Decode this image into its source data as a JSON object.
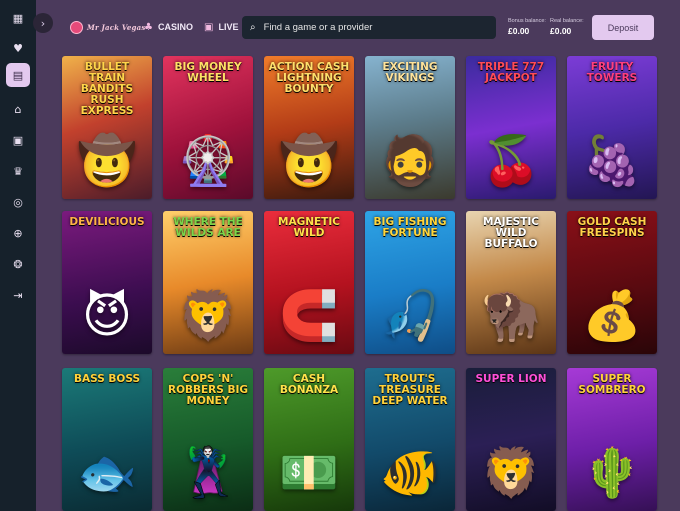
{
  "sidebar": {
    "icons": [
      "grid-icon",
      "heart-icon",
      "casino-chip-icon",
      "bank-icon",
      "gift-icon",
      "trophy-icon",
      "target-icon",
      "plus-circle-icon",
      "coins-icon",
      "logout-icon"
    ],
    "glyphs": [
      "▦",
      "♥",
      "▤",
      "⌂",
      "▣",
      "♛",
      "◎",
      "⊕",
      "❂",
      "⇥"
    ]
  },
  "header": {
    "logo_text": "Mr Jack Vegas",
    "nav": [
      {
        "label": "CASINO",
        "glyph": "♣"
      },
      {
        "label": "LIVE",
        "glyph": "▣"
      }
    ],
    "search": {
      "placeholder": "Find a game or a provider",
      "glyph": "⌕"
    },
    "bonus_balance": {
      "label": "Bonus balance:",
      "value": "£0.00"
    },
    "real_balance": {
      "label": "Real balance:",
      "value": "£0.00"
    },
    "deposit_label": "Deposit"
  },
  "games": [
    {
      "title": "Bullet Train Bandits Rush Express",
      "bg": "linear-gradient(160deg,#f0b24a 0%,#c2412d 45%,#4b1c2a 100%)",
      "color": "#ffd54a",
      "art": "🤠"
    },
    {
      "title": "Big Money Wheel",
      "bg": "linear-gradient(160deg,#e2345e 0%,#a0123c 55%,#5a0a2a 100%)",
      "color": "#ffe066",
      "art": "🎡"
    },
    {
      "title": "Action Cash Lightning Bounty",
      "bg": "linear-gradient(170deg,#f07c2a 0%,#b33c17 50%,#3c1a0e 100%)",
      "color": "#ffdf6b",
      "art": "🤠"
    },
    {
      "title": "Exciting Vikings",
      "bg": "linear-gradient(170deg,#86b3cf 0%,#5d7d8c 45%,#3b3a2e 100%)",
      "color": "#ffe39a",
      "art": "🧔"
    },
    {
      "title": "Triple 777 Jackpot",
      "bg": "linear-gradient(170deg,#3b2b9e 0%,#7b2fd0 50%,#2a1a6e 100%)",
      "color": "#ff4b57",
      "art": "🍒"
    },
    {
      "title": "Fruity Towers",
      "bg": "linear-gradient(170deg,#7c3cd6 0%,#4c2aa8 50%,#231653 100%)",
      "color": "#ff3f7f",
      "art": "🍇"
    },
    {
      "title": "Devilicious",
      "bg": "linear-gradient(170deg,#7b1a7e 0%,#3b0d4f 60%,#1c0a2a 100%)",
      "color": "#ffb347",
      "art": "😈"
    },
    {
      "title": "Where the Wilds Are",
      "bg": "linear-gradient(170deg,#ffcf6b 0%,#e88a2a 50%,#6d3b14 100%)",
      "color": "#7ad64a",
      "art": "🦁"
    },
    {
      "title": "Magnetic Wild",
      "bg": "linear-gradient(170deg,#ea2d3c 0%,#b4121f 55%,#6a0a12 100%)",
      "color": "#ffe14a",
      "art": "🧲"
    },
    {
      "title": "Big Fishing Fortune",
      "bg": "linear-gradient(170deg,#2ea4e6 0%,#1a7dc7 55%,#0f4d86 100%)",
      "color": "#ffd53a",
      "art": "🎣"
    },
    {
      "title": "Majestic Wild Buffalo",
      "bg": "linear-gradient(170deg,#e8d4b0 0%,#c48a4a 45%,#5b3516 100%)",
      "color": "#ffffff",
      "art": "🦬"
    },
    {
      "title": "Gold Cash Freespins",
      "bg": "linear-gradient(170deg,#8a1018 0%,#5a0a10 55%,#2a0508 100%)",
      "color": "#ffd24a",
      "art": "💰"
    },
    {
      "title": "Bass Boss",
      "bg": "linear-gradient(170deg,#1b7a78 0%,#0e4b57 55%,#0a2b33 100%)",
      "color": "#ffd23a",
      "art": "🐟"
    },
    {
      "title": "Cops 'n' Robbers Big Money",
      "bg": "linear-gradient(170deg,#2a7e3a 0%,#165a2a 55%,#0b2d15 100%)",
      "color": "#ffd23a",
      "art": "🦹"
    },
    {
      "title": "Cash Bonanza",
      "bg": "linear-gradient(170deg,#4e9a2a 0%,#2f6e16 55%,#16380a 100%)",
      "color": "#ffe24a",
      "art": "💵"
    },
    {
      "title": "Trout's Treasure Deep Water",
      "bg": "linear-gradient(170deg,#1e6d8f 0%,#124a6a 55%,#0a2638 100%)",
      "color": "#ffd23a",
      "art": "🐠"
    },
    {
      "title": "Super Lion",
      "bg": "linear-gradient(170deg,#1a1e3a 0%,#2b1f55 50%,#120d26 100%)",
      "color": "#ff4fd8",
      "art": "🦁"
    },
    {
      "title": "Super Sombrero",
      "bg": "linear-gradient(170deg,#a63ad6 0%,#6d1fa8 55%,#351055 100%)",
      "color": "#ffd23a",
      "art": "🌵"
    }
  ]
}
